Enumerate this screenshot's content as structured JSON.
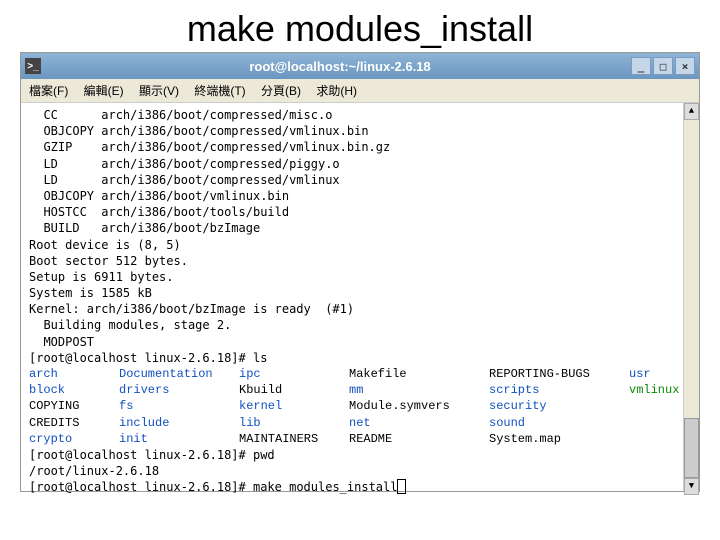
{
  "slide_title": "make modules_install",
  "titlebar": {
    "text": "root@localhost:~/linux-2.6.18",
    "btn_min": "_",
    "btn_max": "□",
    "btn_close": "×"
  },
  "menu": {
    "file": "檔案(F)",
    "edit": "編輯(E)",
    "view": "顯示(V)",
    "terminal": "終端機(T)",
    "tabs": "分頁(B)",
    "help": "求助(H)"
  },
  "build": [
    {
      "k": "CC",
      "v": "arch/i386/boot/compressed/misc.o"
    },
    {
      "k": "OBJCOPY",
      "v": "arch/i386/boot/compressed/vmlinux.bin"
    },
    {
      "k": "GZIP",
      "v": "arch/i386/boot/compressed/vmlinux.bin.gz"
    },
    {
      "k": "LD",
      "v": "arch/i386/boot/compressed/piggy.o"
    },
    {
      "k": "LD",
      "v": "arch/i386/boot/compressed/vmlinux"
    },
    {
      "k": "OBJCOPY",
      "v": "arch/i386/boot/vmlinux.bin"
    },
    {
      "k": "HOSTCC",
      "v": "arch/i386/boot/tools/build"
    },
    {
      "k": "BUILD",
      "v": "arch/i386/boot/bzImage"
    }
  ],
  "msgs": {
    "root_dev": "Root device is (8, 5)",
    "boot_sect": "Boot sector 512 bytes.",
    "setup": "Setup is 6911 bytes.",
    "system": "System is 1585 kB",
    "kernel": "Kernel: arch/i386/boot/bzImage is ready  (#1)",
    "building": "  Building modules, stage 2.",
    "modpost": "  MODPOST"
  },
  "prompt1": "[root@localhost linux-2.6.18]# ",
  "cmd1": "ls",
  "ls": {
    "r0": [
      "arch",
      "Documentation",
      "ipc",
      "Makefile",
      "REPORTING-BUGS",
      "usr"
    ],
    "r1": [
      "block",
      "drivers",
      "Kbuild",
      "mm",
      "scripts",
      "vmlinux"
    ],
    "r2": [
      "COPYING",
      "fs",
      "kernel",
      "Module.symvers",
      "security",
      ""
    ],
    "r3": [
      "CREDITS",
      "include",
      "lib",
      "net",
      "sound",
      ""
    ],
    "r4": [
      "crypto",
      "init",
      "MAINTAINERS",
      "README",
      "System.map",
      ""
    ]
  },
  "prompt2": "[root@localhost linux-2.6.18]# ",
  "cmd2": "pwd",
  "pwd_out": "/root/linux-2.6.18",
  "prompt3": "[root@localhost linux-2.6.18]# ",
  "cmd3": "make modules_install",
  "sb": {
    "up": "▲",
    "down": "▼"
  }
}
